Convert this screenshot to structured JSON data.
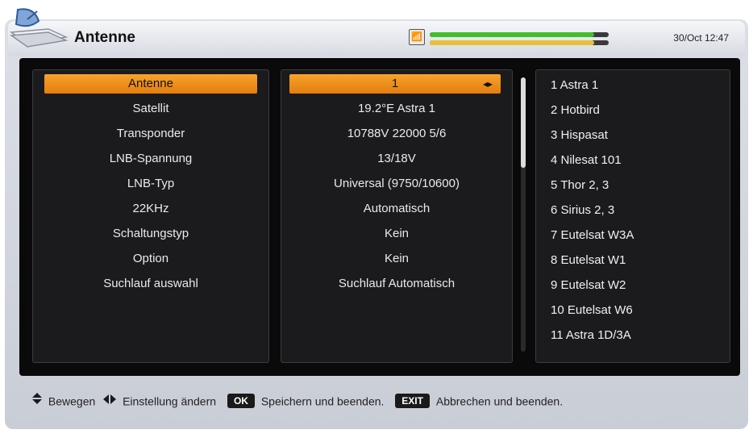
{
  "header": {
    "title": "Antenne",
    "datetime": "30/Oct 12:47",
    "signal_icon": "antenna-signal-icon",
    "strength_level": 0.92,
    "quality_level": 0.92,
    "strength_color": "#3fbf2a",
    "quality_color": "#e8c13a"
  },
  "settings": {
    "labels": [
      "Antenne",
      "Satellit",
      "Transponder",
      "LNB-Spannung",
      "LNB-Typ",
      "22KHz",
      "Schaltungstyp",
      "Option",
      "Suchlauf auswahl"
    ],
    "values": [
      "1",
      "19.2°E Astra 1",
      "10788V 22000 5/6",
      "13/18V",
      "Universal (9750/10600)",
      "Automatisch",
      "Kein",
      "Kein",
      "Suchlauf Automatisch"
    ],
    "selected_index": 0,
    "highlight_color": "#f39a24"
  },
  "satellites": [
    "1 Astra 1",
    "2 Hotbird",
    "3 Hispasat",
    "4 Nilesat 101",
    "5 Thor 2, 3",
    "6 Sirius 2, 3",
    "7 Eutelsat W3A",
    "8 Eutelsat W1",
    "9 Eutelsat W2",
    "10 Eutelsat W6",
    "11 Astra 1D/3A"
  ],
  "footer": {
    "move_label": "Bewegen",
    "change_label": "Einstellung ändern",
    "ok_key": "OK",
    "ok_label": "Speichern und beenden.",
    "exit_key": "EXIT",
    "exit_label": "Abbrechen und beenden."
  }
}
